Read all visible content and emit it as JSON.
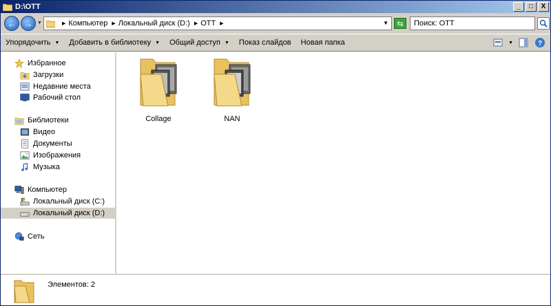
{
  "window": {
    "title": "D:\\OTT",
    "btn_min": "_",
    "btn_max": "□",
    "btn_close": "X"
  },
  "address": {
    "crumbs": [
      "Компьютер",
      "Локальный диск (D:)",
      "OTT"
    ]
  },
  "search": {
    "placeholder": "Поиск: OTT"
  },
  "toolbar": {
    "organize": "Упорядочить",
    "add_library": "Добавить в библиотеку",
    "share": "Общий доступ",
    "slideshow": "Показ слайдов",
    "new_folder": "Новая папка"
  },
  "nav": {
    "favorites": "Избранное",
    "downloads": "Загрузки",
    "recent": "Недавние места",
    "desktop": "Рабочий стол",
    "libraries": "Библиотеки",
    "video": "Видео",
    "documents": "Документы",
    "images": "Изображения",
    "music": "Музыка",
    "computer": "Компьютер",
    "disk_c": "Локальный диск (C:)",
    "disk_d": "Локальный диск (D:)",
    "network": "Сеть"
  },
  "folders": [
    {
      "name": "Collage"
    },
    {
      "name": "NAN"
    }
  ],
  "details": {
    "count": "Элементов: 2"
  },
  "colors": {
    "title_gradient_start": "#0a246a",
    "title_gradient_end": "#a6caf0",
    "folder": "#f2d27a",
    "selected": "#d4d0c8"
  }
}
